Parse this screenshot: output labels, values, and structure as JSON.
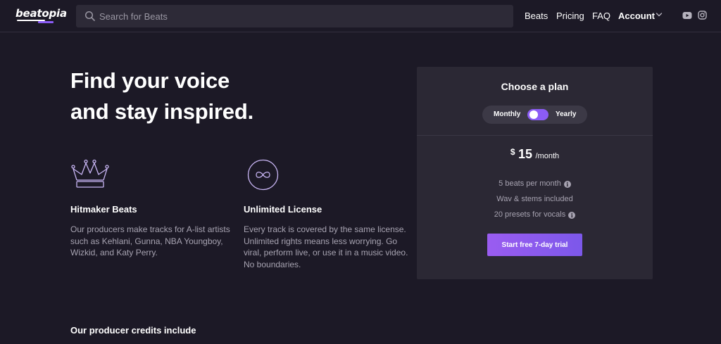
{
  "header": {
    "logo": "beatopia",
    "search": {
      "placeholder": "Search for Beats",
      "value": ""
    },
    "nav": {
      "beats": "Beats",
      "pricing": "Pricing",
      "faq": "FAQ",
      "account": "Account"
    },
    "icons": [
      "search-icon",
      "chevron-down-icon",
      "youtube-icon",
      "instagram-icon"
    ]
  },
  "hero": {
    "title_line1": "Find your voice",
    "title_line2": "and stay inspired."
  },
  "features": [
    {
      "icon": "crown-icon",
      "title": "Hitmaker Beats",
      "description": "Our producers make tracks for A-list artists such as Kehlani, Gunna, NBA Youngboy, Wizkid, and Katy Perry."
    },
    {
      "icon": "infinity-icon",
      "title": "Unlimited License",
      "description": "Every track is covered by the same license. Unlimited rights means less worrying. Go viral, perform live, or use it in a music video. No boundaries."
    }
  ],
  "credits": {
    "title": "Our producer credits include"
  },
  "plan": {
    "title": "Choose a plan",
    "toggle": {
      "left": "Monthly",
      "right": "Yearly",
      "selected": "Monthly"
    },
    "price": {
      "currency": "$",
      "amount": "15",
      "period": "/month"
    },
    "features": [
      {
        "text": "5 beats per month",
        "info": true
      },
      {
        "text": "Wav & stems included",
        "info": false
      },
      {
        "text": "20 presets for vocals",
        "info": true
      }
    ],
    "cta": "Start free 7-day trial"
  },
  "colors": {
    "background": "#1c1926",
    "card": "#2b2834",
    "accent": "#8b5cf6",
    "muted_text": "#a7a3b1"
  }
}
